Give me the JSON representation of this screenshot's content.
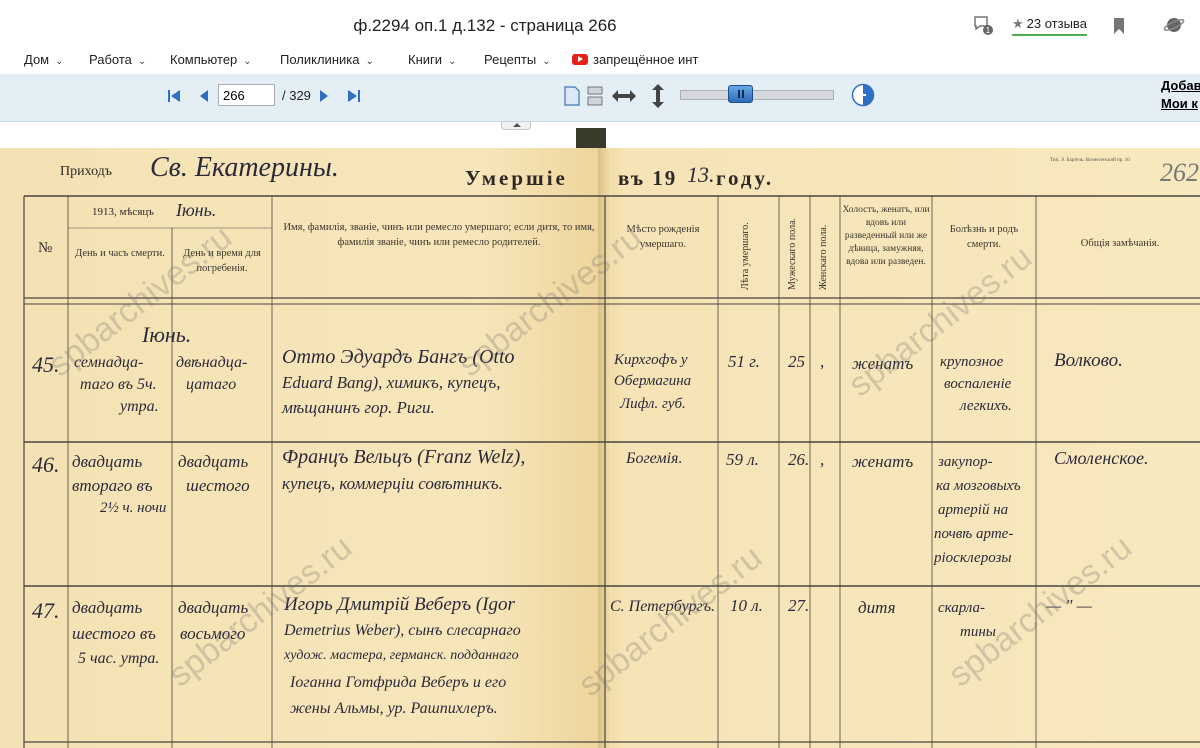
{
  "window": {
    "title": "ф.2294 оп.1 д.132 - страница 266",
    "reviews": "23 отзыва"
  },
  "bookmarks": [
    {
      "label": "Дом"
    },
    {
      "label": "Работа"
    },
    {
      "label": "Компьютер"
    },
    {
      "label": "Поликлиника"
    },
    {
      "label": "Книги"
    },
    {
      "label": "Рецепты"
    },
    {
      "label": "запрещённое инт"
    }
  ],
  "viewer": {
    "page": "266",
    "total": "/ 329",
    "zoom_fraction": 0.37
  },
  "side_links": [
    "Добав",
    "Мои к"
  ],
  "scan": {
    "parish_label": "Приходъ",
    "parish_name": "Св. Екатерины.",
    "heading_left": "Умершiе",
    "heading_right": "въ 19",
    "year_hand": "13.",
    "heading_end": "году.",
    "page_num": "262",
    "corner_stamp": "Тип. Э. Бартель. Вознесенский пр. 10",
    "month_line": "1913, мѣсяцъ",
    "month_hand": "Iюнь.",
    "columns": {
      "num": "№",
      "death": "День и часъ смерти.",
      "burial": "День и время для погребенія.",
      "name": "Имя, фамилія, званіе, чинъ или ремесло умершаго; если дитя, то имя, фамилія званіе, чинъ или ремесло родителей.",
      "birthplace": "Мѣсто рожденія умершаго.",
      "age": "Лѣта умершаго.",
      "male": "Мужескаго пола.",
      "female": "Женскаго пола.",
      "status": "Холостъ, женатъ, или вдовъ или разведенный или же дѣвица, замужняя, вдова или разведен.",
      "disease": "Болѣзнь и родъ смерти.",
      "notes": "Общія замѣчанія."
    },
    "month_in_table": "Iюнь.",
    "rows": [
      {
        "num": "45.",
        "death": [
          "семнадца-",
          "таго въ 5ч.",
          "утра."
        ],
        "burial": [
          "двѣнадца-",
          "цатаго"
        ],
        "name": [
          "Отто Эдуардъ Бангъ (Otto",
          "Eduard Bang), химикъ, купецъ,",
          "мѣщанинъ гор. Риги."
        ],
        "birthplace": [
          "Кирхгофъ у",
          "Обермагина",
          "Лифл. губ."
        ],
        "age": "51 г.",
        "male": "25",
        "female": ",",
        "status": "женатъ",
        "disease": [
          "крупозное",
          "воспаленіе",
          "легкихъ."
        ],
        "notes": "Волково."
      },
      {
        "num": "46.",
        "death": [
          "двадцать",
          "втораго въ",
          "2½ ч. ночи"
        ],
        "burial": [
          "двадцать",
          "шестого"
        ],
        "name": [
          "Францъ Вельцъ (Franz Welz),",
          "купецъ, коммерціи совѣтникъ."
        ],
        "birthplace": [
          "Богемія."
        ],
        "age": "59 л.",
        "male": "26.",
        "female": ",",
        "status": "женатъ",
        "disease": [
          "закупор-",
          "ка мозговыхъ",
          "артерій на",
          "почвѣ арте-",
          "ріосклерозы"
        ],
        "notes": "Смоленское."
      },
      {
        "num": "47.",
        "death": [
          "двадцать",
          "шестого въ",
          "5 час. утра."
        ],
        "burial": [
          "двадцать",
          "восьмого"
        ],
        "name": [
          "Игорь Дмитрій Веберъ (Igor",
          "Demetrius Weber), сынъ слесарнаго",
          "худож. мастера, германск. подданнаго",
          "Іоганна Готфрида Веберъ и его",
          "жены Альмы, ур. Рашпихлеръ."
        ],
        "birthplace": [
          "С. Петербургъ."
        ],
        "age": "10 л.",
        "male": "27.",
        "female": "",
        "status": "дитя",
        "disease": [
          "скарла-",
          "тины"
        ],
        "notes": "— ″ —"
      }
    ],
    "watermark": "spbarchives.ru"
  }
}
